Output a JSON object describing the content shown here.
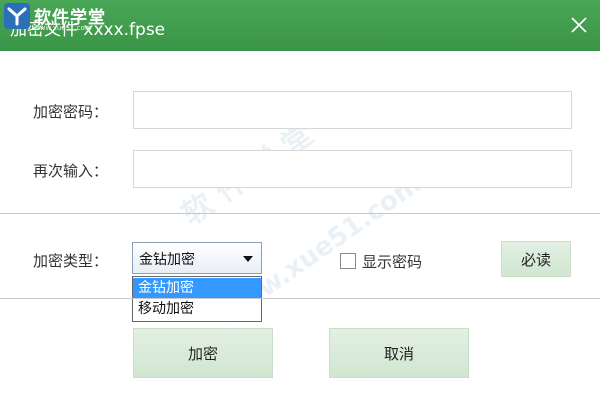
{
  "title_bar": {
    "window_title": "加密文件 xxxx.fpse",
    "logo_text": "软件学堂",
    "logo_subtext": "www.xue51.com",
    "close_icon": "close-icon"
  },
  "form": {
    "password_label": "加密密码：",
    "password_value": "",
    "confirm_label": "再次输入：",
    "confirm_value": "",
    "type_label": "加密类型：",
    "type_selected": "金钻加密",
    "type_options": [
      "金钻加密",
      "移动加密"
    ],
    "show_password_label": "显示密码",
    "show_password_checked": false,
    "must_read_label": "必读"
  },
  "actions": {
    "encrypt_label": "加密",
    "cancel_label": "取消"
  },
  "watermark": {
    "text": "软 件 学 堂",
    "url": "www.xue51.com"
  },
  "colors": {
    "titlebar": "#3a9646",
    "button": "#d6e9d6",
    "selection": "#3399ff"
  }
}
